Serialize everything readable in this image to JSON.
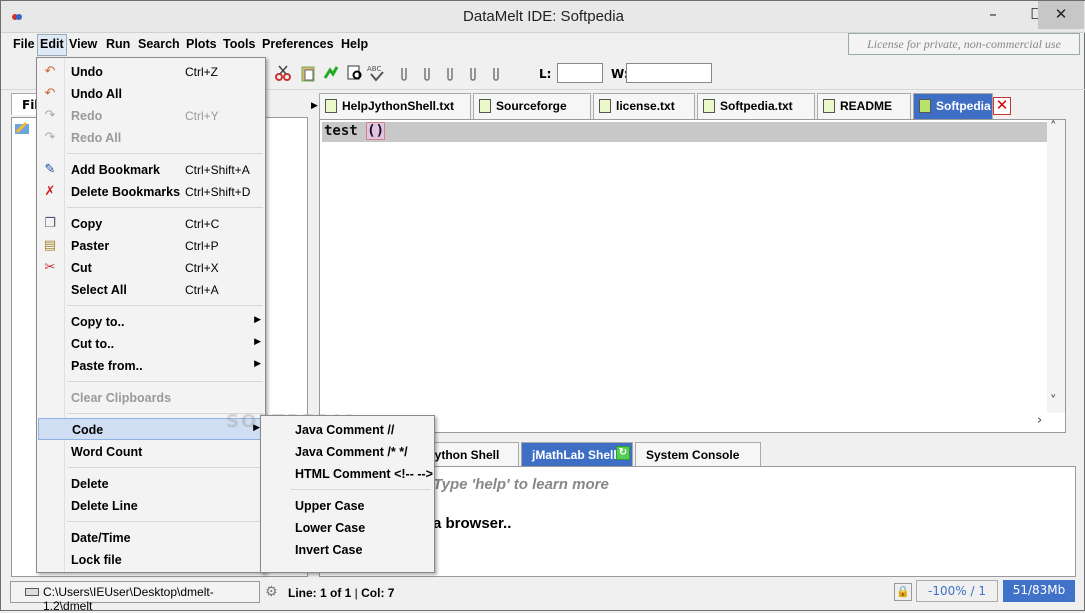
{
  "window": {
    "title": "DataMelt IDE: Softpedia",
    "minimize": "–",
    "maximize": "☐",
    "close": "✕"
  },
  "menubar": {
    "items": [
      "File",
      "Edit",
      "View",
      "Run",
      "Search",
      "Plots",
      "Tools",
      "Preferences",
      "Help"
    ],
    "active": "Edit"
  },
  "license": "License for private, non-commercial use",
  "toolbar": {
    "l_label": "L:",
    "w_label": "W:",
    "l_value": "",
    "w_value": ""
  },
  "left_panel": {
    "tab_label": "File"
  },
  "editor_tabs": [
    {
      "label": "HelpJythonShell.txt",
      "selected": false
    },
    {
      "label": "Sourceforge",
      "selected": false
    },
    {
      "label": "license.txt",
      "selected": false
    },
    {
      "label": "Softpedia.txt",
      "selected": false
    },
    {
      "label": "README",
      "selected": false
    },
    {
      "label": "Softpedia",
      "selected": true
    }
  ],
  "editor": {
    "code_prefix": "test ",
    "code_paren_open": "(",
    "code_paren_close": ")"
  },
  "bottom_tabs": [
    {
      "label": "Jython Shell",
      "selected": false
    },
    {
      "label": "jMathLab Shell",
      "selected": true
    },
    {
      "label": "System Console",
      "selected": false
    }
  ],
  "console": {
    "help_text": "Type 'help' to learn more",
    "browser_text": "a browser.."
  },
  "status": {
    "path": "C:\\Users\\IEUser\\Desktop\\dmelt-1.2\\dmelt",
    "line_label": "Line: 1 of 1",
    "col_label": "Col: 7",
    "zoom": "-100% / 1",
    "memory": "51/83Mb"
  },
  "edit_menu": [
    {
      "label": "Undo",
      "shortcut": "Ctrl+Z",
      "icon": "undo-icon",
      "disabled": false
    },
    {
      "label": "Undo All",
      "shortcut": "",
      "icon": "undo-all-icon",
      "disabled": false
    },
    {
      "label": "Redo",
      "shortcut": "Ctrl+Y",
      "icon": "redo-icon",
      "disabled": true
    },
    {
      "label": "Redo All",
      "shortcut": "",
      "icon": "redo-all-icon",
      "disabled": true
    },
    {
      "label": "Add Bookmark",
      "shortcut": "Ctrl+Shift+A",
      "icon": "bookmark-add-icon",
      "disabled": false
    },
    {
      "label": "Delete Bookmarks",
      "shortcut": "Ctrl+Shift+D",
      "icon": "bookmark-delete-icon",
      "disabled": false
    },
    {
      "label": "Copy",
      "shortcut": "Ctrl+C",
      "icon": "copy-icon",
      "disabled": false
    },
    {
      "label": "Paster",
      "shortcut": "Ctrl+P",
      "icon": "paste-icon",
      "disabled": false
    },
    {
      "label": "Cut",
      "shortcut": "Ctrl+X",
      "icon": "cut-icon",
      "disabled": false
    },
    {
      "label": "Select All",
      "shortcut": "Ctrl+A",
      "icon": "",
      "disabled": false
    },
    {
      "label": "Copy to..",
      "shortcut": "",
      "icon": "",
      "disabled": false,
      "submenu": true
    },
    {
      "label": "Cut to..",
      "shortcut": "",
      "icon": "",
      "disabled": false,
      "submenu": true
    },
    {
      "label": "Paste from..",
      "shortcut": "",
      "icon": "",
      "disabled": false,
      "submenu": true
    },
    {
      "label": "Clear Clipboards",
      "shortcut": "",
      "icon": "",
      "disabled": true
    },
    {
      "label": "Code",
      "shortcut": "",
      "icon": "",
      "disabled": false,
      "submenu": true,
      "highlighted": true
    },
    {
      "label": "Word Count",
      "shortcut": "",
      "icon": "",
      "disabled": false
    },
    {
      "label": "Delete",
      "shortcut": "",
      "icon": "",
      "disabled": false
    },
    {
      "label": "Delete Line",
      "shortcut": "",
      "icon": "",
      "disabled": false
    },
    {
      "label": "Date/Time",
      "shortcut": "",
      "icon": "",
      "disabled": false
    },
    {
      "label": "Lock file",
      "shortcut": "",
      "icon": "",
      "disabled": false
    }
  ],
  "code_submenu": [
    "Java Comment //",
    "Java Comment /* */",
    "HTML Comment <!-- -->",
    "Upper Case",
    "Lower Case",
    "Invert Case"
  ],
  "watermark": "SOFTPEDIA"
}
